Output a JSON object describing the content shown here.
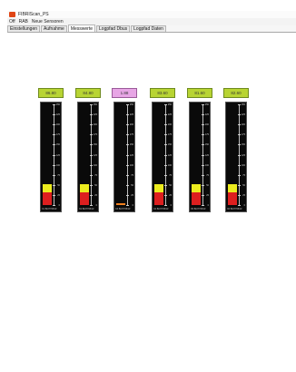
{
  "window": {
    "title": "FIBRIScan_PS",
    "menu": [
      "Off",
      "RAB",
      "Neue Sensoren"
    ]
  },
  "tabs": [
    {
      "label": "Einstellungen",
      "active": false
    },
    {
      "label": "Aufnahme",
      "active": false
    },
    {
      "label": "Messwerte",
      "active": true
    },
    {
      "label": "Logpfad Dbus",
      "active": false
    },
    {
      "label": "Logpfad Daten",
      "active": false
    }
  ],
  "scale": [
    "250",
    "225",
    "200",
    "175",
    "150",
    "125",
    "100",
    "75",
    "50",
    "25",
    "0"
  ],
  "meters": [
    {
      "value": "86.80",
      "state": "ok",
      "caption": "X1 BCH7651R"
    },
    {
      "value": "84.80",
      "state": "ok",
      "caption": "X2 BCH7651R"
    },
    {
      "value": "1.88",
      "state": "warn",
      "caption": "X3 BCH7651R"
    },
    {
      "value": "83.60",
      "state": "ok",
      "caption": "X4 BCH7651R"
    },
    {
      "value": "81.60",
      "state": "ok",
      "caption": "X5 BCH7651R"
    },
    {
      "value": "82.60",
      "state": "ok",
      "caption": "X6 BCH7651R"
    }
  ],
  "colors": {
    "value_ok": "#b8d433",
    "value_warn": "#e7a6e5",
    "bar_red": "#dd1f1f",
    "bar_yellow": "#ecec1e",
    "gauge_bg": "#0a0a0a"
  }
}
